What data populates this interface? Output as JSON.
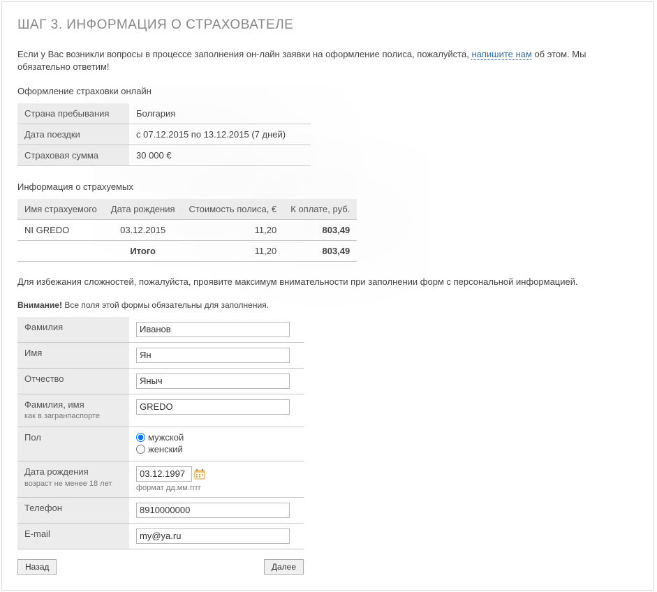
{
  "heading": "ШАГ 3. ИНФОРМАЦИЯ О СТРАХОВАТЕЛЕ",
  "intro_pre": "Если у Вас возникли вопросы в процессе заполнения он-лайн заявки на оформление полиса, пожалуйста, ",
  "intro_link": "напишите нам",
  "intro_post": " об этом. Мы обязательно ответим!",
  "subhead1": "Оформление страховки онлайн",
  "info": {
    "country_label": "Страна пребывания",
    "country_value": "Болгария",
    "dates_label": "Дата поездки",
    "dates_value": "с 07.12.2015   по 13.12.2015 (7 дней)",
    "sum_label": "Страховая сумма",
    "sum_value": "30 000 €"
  },
  "subhead2": "Информация о страхуемых",
  "insured": {
    "headers": {
      "name": "Имя страхуемого",
      "dob": "Дата рождения",
      "cost": "Стоимость полиса, €",
      "pay": "К оплате, руб."
    },
    "rows": [
      {
        "name": "NI GREDO",
        "dob": "03.12.2015",
        "cost": "11,20",
        "pay": "803,49"
      }
    ],
    "total_label": "Итого",
    "total_cost": "11,20",
    "total_pay": "803,49"
  },
  "note": "Для избежания сложностей, пожалуйста, проявите максимум внимательности при заполнении форм с персональной информацией.",
  "warn_bold": "Внимание!",
  "warn_rest": " Все поля этой формы обязательны для заполнения.",
  "form": {
    "lastname": {
      "label": "Фамилия",
      "value": "Иванов"
    },
    "firstname": {
      "label": "Имя",
      "value": "Ян"
    },
    "patronymic": {
      "label": "Отчество",
      "value": "Яныч"
    },
    "passport": {
      "label": "Фамилия, имя",
      "hint": "как в загранпаспорте",
      "value": "GREDO"
    },
    "gender": {
      "label": "Пол",
      "male": "мужской",
      "female": "женский",
      "selected": "male"
    },
    "dob": {
      "label": "Дата рождения",
      "hint": "возраст не менее 18 лет",
      "value": "03.12.1997",
      "format": "формат дд.мм.гггг"
    },
    "phone": {
      "label": "Телефон",
      "value": "8910000000"
    },
    "email": {
      "label": "E-mail",
      "value": "my@ya.ru"
    }
  },
  "buttons": {
    "back": "Назад",
    "next": "Далее"
  }
}
